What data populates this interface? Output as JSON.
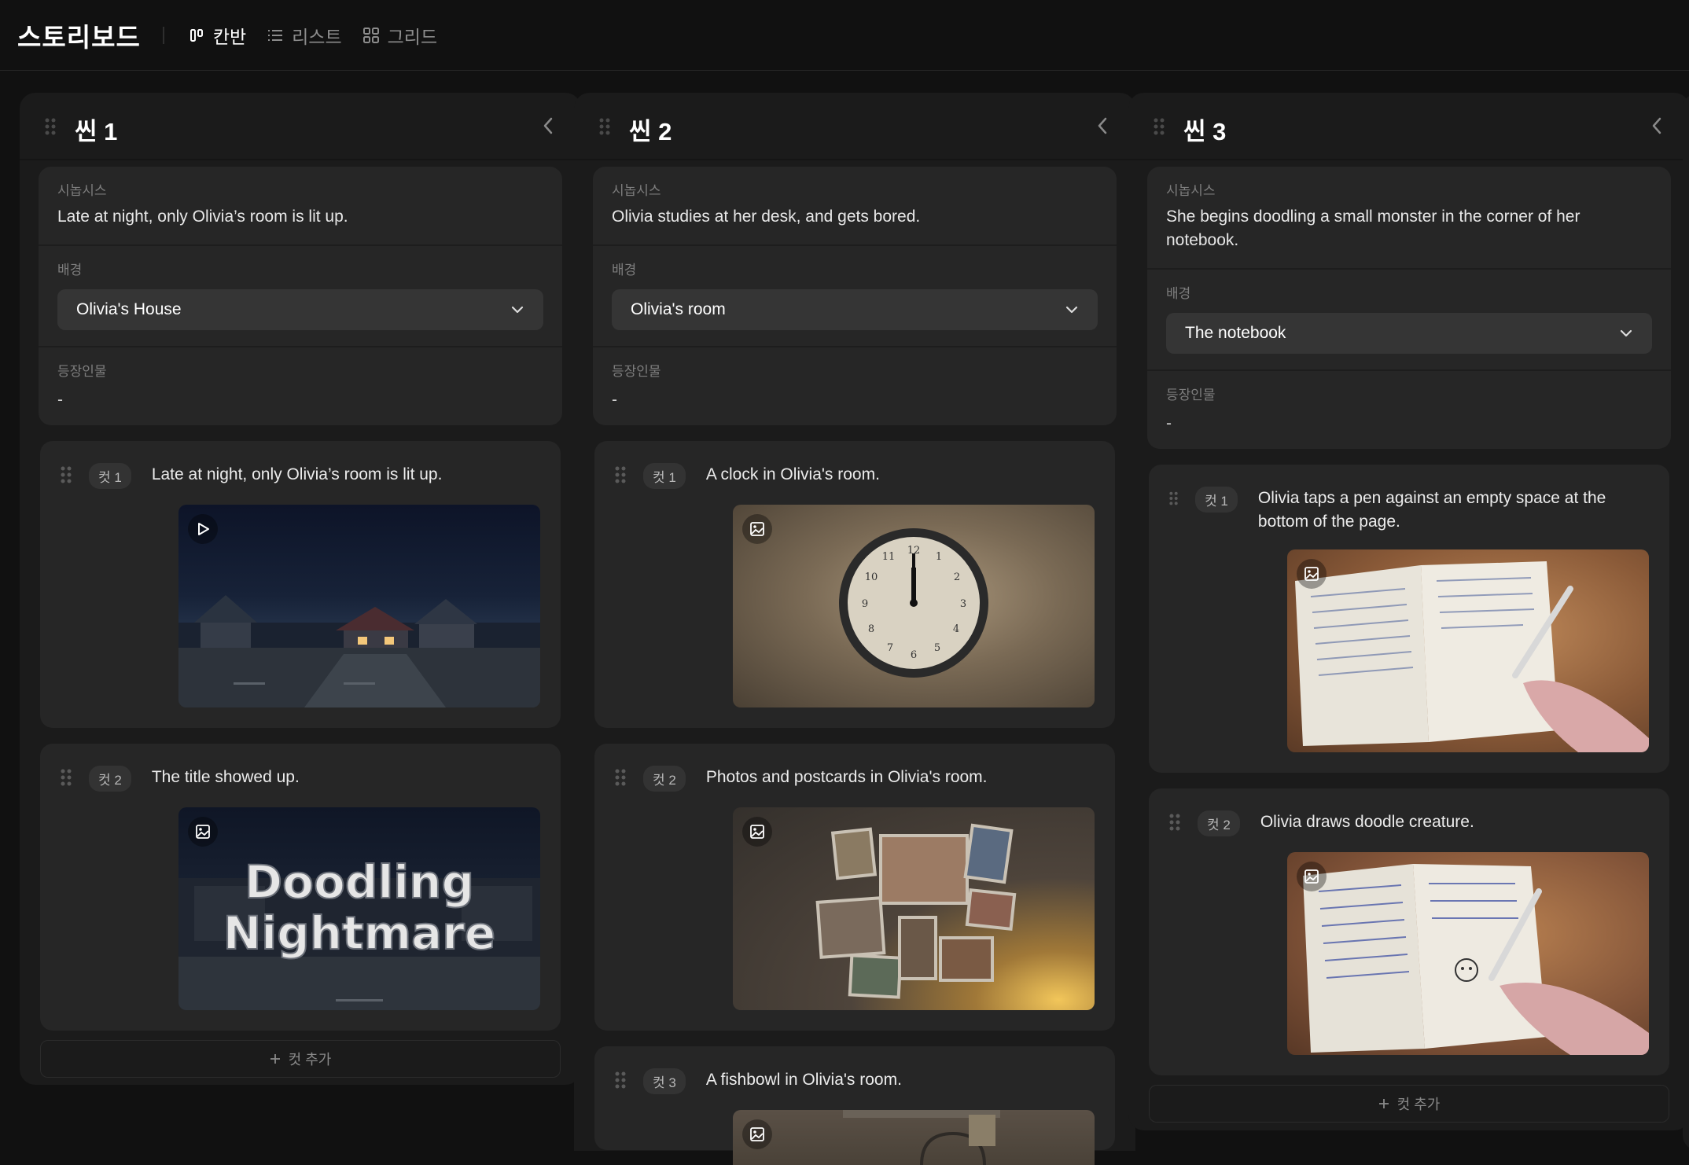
{
  "app": {
    "title": "스토리보드"
  },
  "views": [
    {
      "label": "칸반",
      "active": true,
      "icon": "kanban-icon"
    },
    {
      "label": "리스트",
      "active": false,
      "icon": "list-icon"
    },
    {
      "label": "그리드",
      "active": false,
      "icon": "grid-icon"
    }
  ],
  "labels": {
    "synopsis": "시놉시스",
    "background": "배경",
    "characters": "등장인물",
    "add_cut": "컷 추가"
  },
  "scenes": [
    {
      "title": "씬 1",
      "synopsis": "Late at night, only Olivia’s room is lit up.",
      "background": "Olivia's House",
      "characters": "-",
      "cuts": [
        {
          "badge": "컷 1",
          "text": "Late at night, only Olivia’s room is lit up.",
          "media": "play-icon",
          "image": "night neighborhood street"
        },
        {
          "badge": "컷 2",
          "text": "The title showed up.",
          "media": "image-icon",
          "image": "title card",
          "title_art": [
            "Doodling",
            "Nightmare"
          ]
        }
      ]
    },
    {
      "title": "씬 2",
      "synopsis": "Olivia studies at her desk, and gets bored.",
      "background": "Olivia's room",
      "characters": "-",
      "cuts": [
        {
          "badge": "컷 1",
          "text": "A clock in Olivia's room.",
          "media": "image-icon",
          "image": "wall clock"
        },
        {
          "badge": "컷 2",
          "text": "Photos and postcards in Olivia's room.",
          "media": "image-icon",
          "image": "photo wall"
        },
        {
          "badge": "컷 3",
          "text": "A fishbowl in Olivia's room.",
          "media": "image-icon",
          "image": "fishbowl"
        }
      ]
    },
    {
      "title": "씬 3",
      "synopsis": "She begins doodling a small monster in the corner of her notebook.",
      "background": "The notebook",
      "characters": "-",
      "cuts": [
        {
          "badge": "컷 1",
          "text": "Olivia taps a pen against an empty space at the bottom of the page.",
          "media": "image-icon",
          "image": "notebook with pen"
        },
        {
          "badge": "컷 2",
          "text": "Olivia draws doodle creature.",
          "media": "image-icon",
          "image": "notebook doodle"
        }
      ]
    }
  ],
  "colors": {
    "background": "#111111",
    "column": "#1b1b1b",
    "card": "#262626",
    "select": "#353535"
  }
}
